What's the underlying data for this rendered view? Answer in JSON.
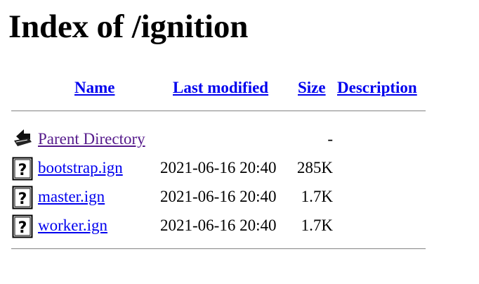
{
  "page_title": "Index of /ignition",
  "columns": {
    "name": "Name",
    "last_modified": "Last modified",
    "size": "Size",
    "description": "Description"
  },
  "parent": {
    "label": "Parent Directory",
    "size": "-",
    "icon": "back-arrow-icon"
  },
  "files": [
    {
      "name": "bootstrap.ign",
      "modified": "2021-06-16 20:40",
      "size": "285K",
      "icon": "unknown-file-icon"
    },
    {
      "name": "master.ign",
      "modified": "2021-06-16 20:40",
      "size": "1.7K",
      "icon": "unknown-file-icon"
    },
    {
      "name": "worker.ign",
      "modified": "2021-06-16 20:40",
      "size": "1.7K",
      "icon": "unknown-file-icon"
    }
  ],
  "colors": {
    "link": "#0000ee",
    "visited_link": "#551a8b",
    "rule": "#9a9a9a"
  }
}
